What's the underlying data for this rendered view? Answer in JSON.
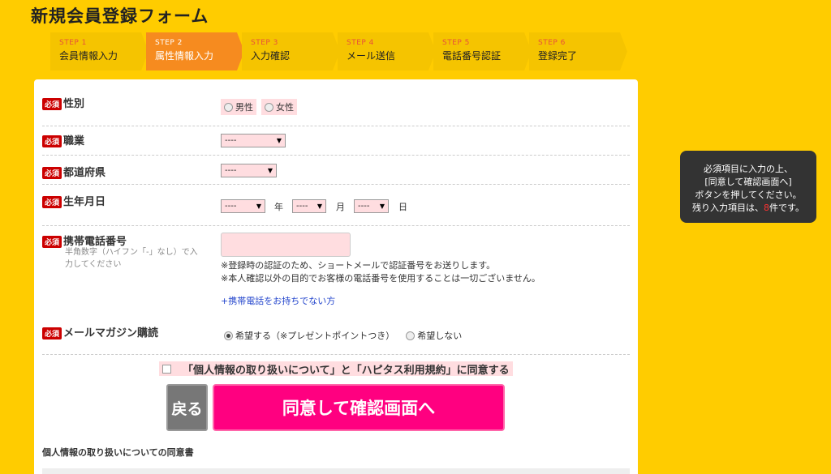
{
  "page": {
    "title": "新規会員登録フォーム"
  },
  "steps": [
    {
      "num": "STEP 1",
      "label": "会員情報入力",
      "active": false
    },
    {
      "num": "STEP 2",
      "label": "属性情報入力",
      "active": true
    },
    {
      "num": "STEP 3",
      "label": "入力確認",
      "active": false
    },
    {
      "num": "STEP 4",
      "label": "メール送信",
      "active": false
    },
    {
      "num": "STEP 5",
      "label": "電話番号認証",
      "active": false
    },
    {
      "num": "STEP 6",
      "label": "登録完了",
      "active": false
    }
  ],
  "form": {
    "required_badge": "必須",
    "gender": {
      "label": "性別",
      "options": [
        "男性",
        "女性"
      ]
    },
    "occupation": {
      "label": "職業",
      "value": "----"
    },
    "prefecture": {
      "label": "都道府県",
      "value": "----"
    },
    "birthdate": {
      "label": "生年月日",
      "year": "----",
      "month": "----",
      "day": "----",
      "year_unit": "年",
      "month_unit": "月",
      "day_unit": "日"
    },
    "phone": {
      "label": "携帯電話番号",
      "hint": "半角数字（ハイフン「-」なし）で入力してください",
      "value": "",
      "note1": "※登録時の認証のため、ショートメールで認証番号をお送りします。",
      "note2": "※本人確認以外の目的でお客様の電話番号を使用することは一切ございません。",
      "no_phone_link": "+携帯電話をお持ちでない方"
    },
    "newsletter": {
      "label": "メールマガジン購読",
      "option_yes": "希望する（※プレゼントポイントつき）",
      "option_no": "希望しない",
      "selected": "yes"
    },
    "agree": {
      "label": "「個人情報の取り扱いについて」と「ハピタス利用規約」に同意する",
      "checked": false
    },
    "back_button": "戻る",
    "confirm_button": "同意して確認画面へ",
    "consent_title": "個人情報の取り扱いについての同意書"
  },
  "tooltip": {
    "line1": "必須項目に入力の上、",
    "line2": "[同意して確認画面へ]",
    "line3": "ボタンを押してください。",
    "line4_prefix": "残り入力項目は、",
    "remaining": "8",
    "line4_suffix": "件です。"
  }
}
